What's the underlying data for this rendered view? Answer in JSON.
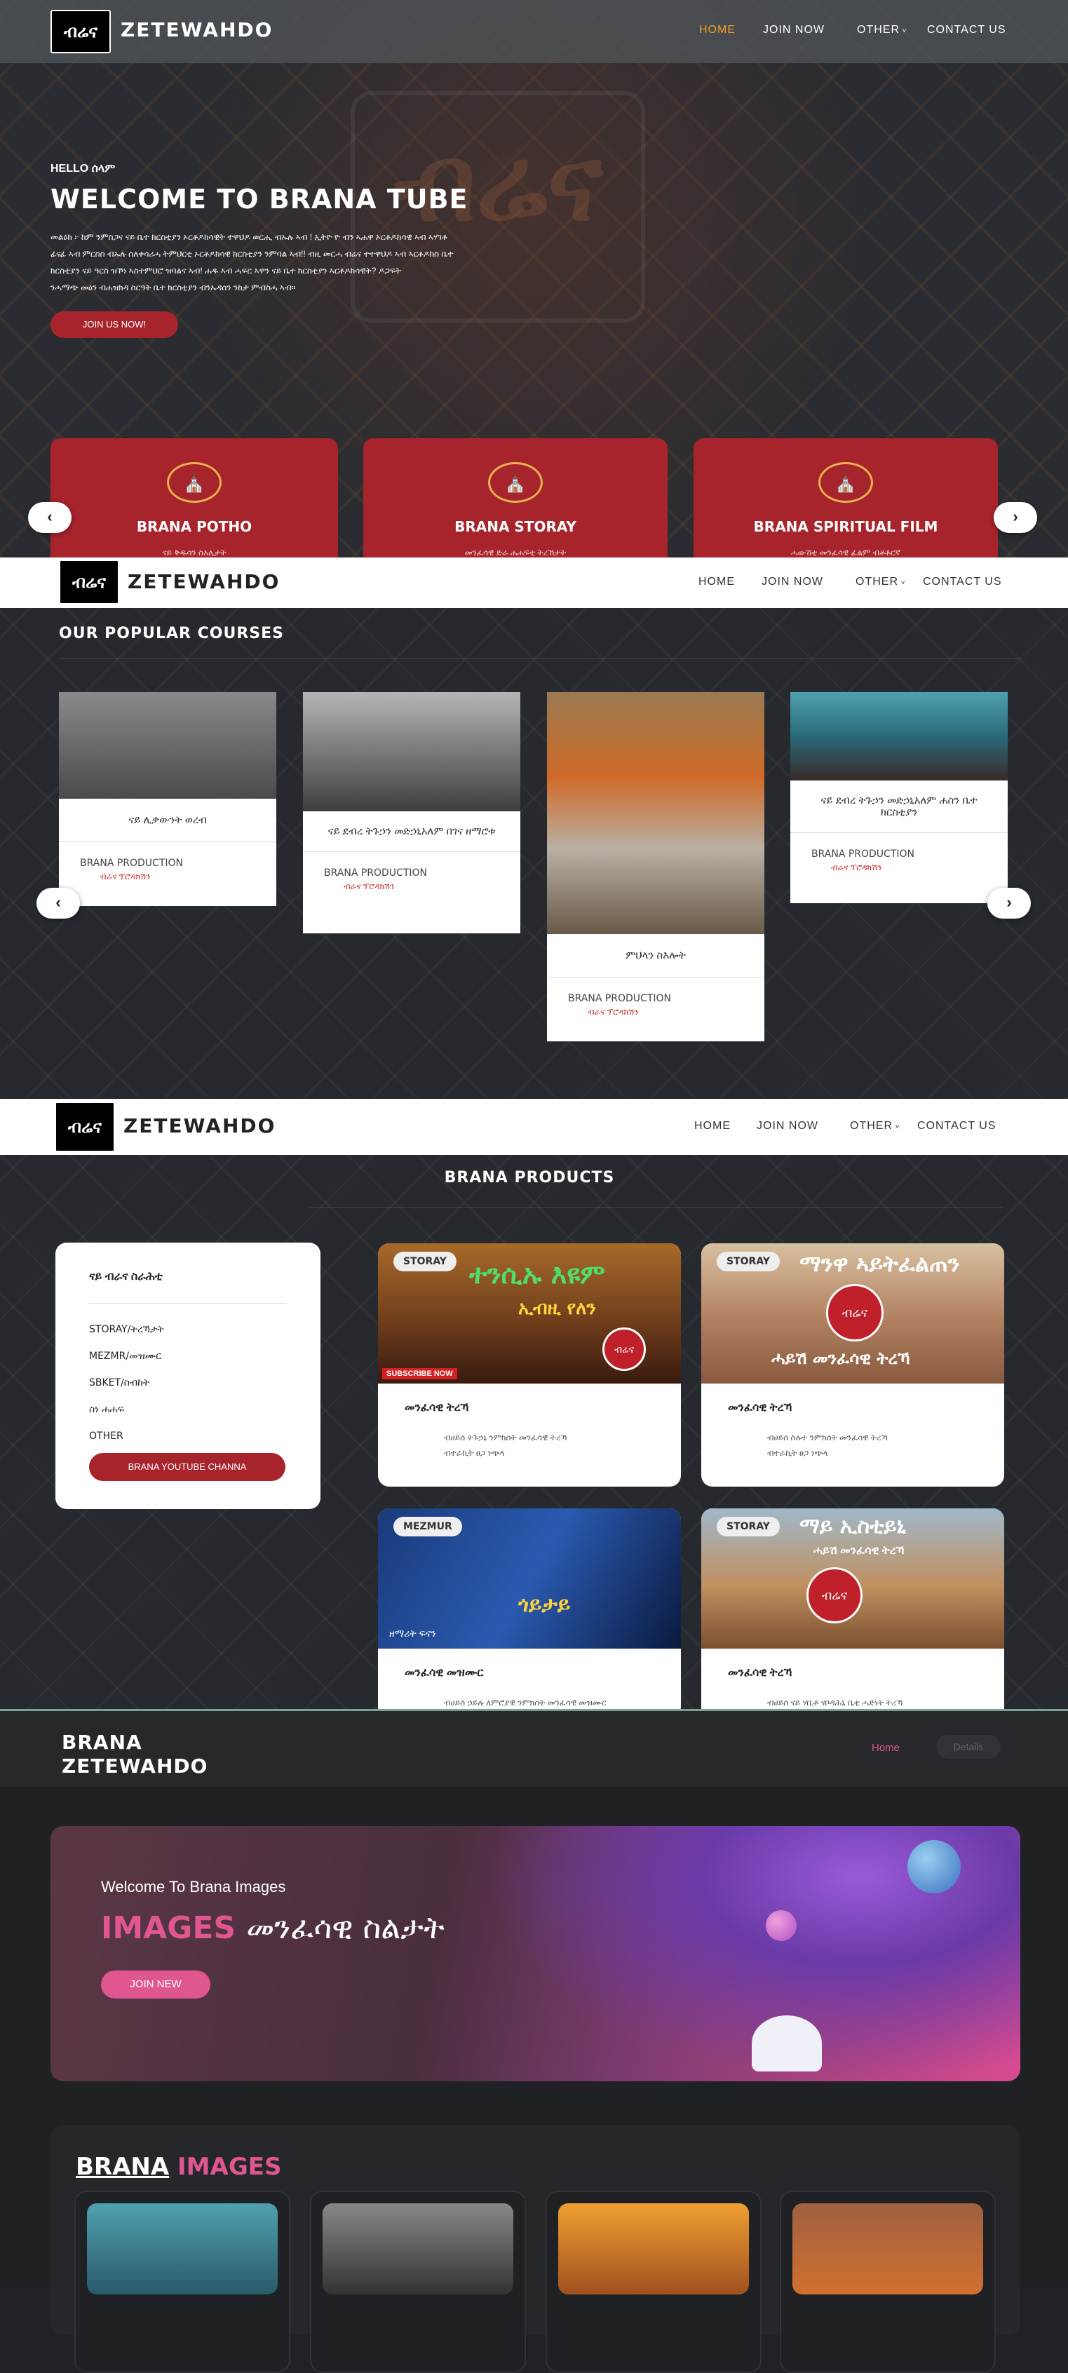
{
  "brand": "ZETEWAHDO",
  "logo_text": "ብሬና",
  "nav": {
    "home": "HOME",
    "join": "JOIN NOW",
    "other": "OTHER",
    "contact": "CONTACT US"
  },
  "hero": {
    "hello": "HELLO ሰላም",
    "title": "WELCOME TO BRANA TUBE",
    "body_line1": "መልዕክ ፦ ከም ንምስጋና ናይ ቤተ ክርስቲያን ኦርቶዶክሳዊት ተዋህዶ ወርሒ ብኡሉ ኣብ ! ኢትዮ ዮ ብን ኣሐዋ ኦርቶዶክሳዊ ኣብ ኣሃገቶ",
    "body_line2": "ፊናፊ ኣብ ምርስስ ብኡሉ ሰለቀሳሪሓ ትምህርቲ ኦርቶዶክሳዊ ክርስቲያን ንምባል ኣብ!! ብዚ መርሓ ብሬና ተተዋህዶ ኣብ ኣርቶዶክስ ቤተ",
    "body_line3": "ክርስቲያን ናይ ዓርስ ዝኾነ ኣስተምህሮ ዝባልና ኣብ! ሐዱ ኣብ ሓፍር ኣዋን ናይ ቤተ ክርስቲያን ኣርቶዶክሳዊት? ዶጋፍት",
    "body_line4": "ንሓማጭ መዕን ብሐዝክዳ ስርዓት ቤተ ክርስቲያን ብንኡዳሰን ንከታ ምብስሓ ኣብ።",
    "join_btn": "JOIN US NOW!"
  },
  "feature_cards": [
    {
      "title": "BRANA POTHO",
      "sub": "ናይ ቅዱሳን ስእሊታት"
    },
    {
      "title": "BRANA STORAY",
      "sub": "መንፈሳዊ ድራ ሐሐፍቲ ትረኽታት"
    },
    {
      "title": "BRANA SPIRITUAL FILM",
      "sub": "ሓውሽቲ መንፈሳዊ ፊልም ብቶቶርኛ"
    }
  ],
  "courses": {
    "heading": "OUR POPULAR COURSES",
    "items": [
      {
        "title": "ናይ ሊቃውንት ወረብ",
        "prod": "BRANA PRODUCTION",
        "sub": "ብራና ፕሮዳክሽን"
      },
      {
        "title": "ናይ ደብረ ትጉኃን መድኃኒአለም በገና ዘማሮቱ",
        "prod": "BRANA PRODUCTION",
        "sub": "ብራና ፕሮዳክሽን"
      },
      {
        "title": "ምህላን ስእሎት",
        "prod": "BRANA PRODUCTION",
        "sub": "ብራና ፕሮዳክሽን"
      },
      {
        "title": "ናይ ደብረ ትጉኃን መድኃኒአለም ሐስን ቤተ ክርስቲያን",
        "prod": "BRANA PRODUCTION",
        "sub": "ብራና ፕሮዳክሽን"
      }
    ]
  },
  "products": {
    "heading": "BRANA PRODUCTS",
    "sidebar_title": "ናይ ብራና ስራሕቲ",
    "categories": [
      "STORAY/ትረኻታት",
      "MEZMR/መዝሙር",
      "SBKET/ስብከት",
      "ስነ ሐሐፍ",
      "OTHER"
    ],
    "youtube_btn": "BRANA YOUTUBE CHANNA",
    "cards": [
      {
        "badge": "STORAY",
        "img_title": "ተንሲኡ እዩም",
        "img_sub": "ኢብዚ የለን",
        "title": "መንፈሳዊ ትረኻ",
        "desc1": "ብሀይሰ ትጉኃኔ ንምክሰት መንፈሳዊ ትረኻ",
        "desc2": "ብተራኪት ፀጋ ነጭላ"
      },
      {
        "badge": "STORAY",
        "img_title": "ማንዋ ኣይትፈልጠን",
        "img_sub": "ሓይሽ መንፈሳዊ ትረኻ",
        "title": "መንፈሳዊ ትረኻ",
        "desc1": "ብሀይሰ ስሉተ ንምክሰት መንፈሳዊ ትረኻ",
        "desc2": "ብተራኪት ፀጋ ነጭላ"
      },
      {
        "badge": "MEZMUR",
        "img_title": "ጎይታይ",
        "img_sub": "ዘማሪት ፍናን",
        "title": "መንፈሳዊ መዝሙር",
        "desc1": "ብሀይሰ ኃይሉ ለምሮያዊ ንምክሰት መንፈሳዊ መዝሙር",
        "desc2": ""
      },
      {
        "badge": "STORAY",
        "img_title": "ማይ ኢስቲይኒ",
        "img_sub": "ሓይሽ መንፈሳዊ ትረኻ",
        "title": "መንፈሳዊ ትረኻ",
        "desc1": "ብሀይሰ ናይ ሃቢቶ ናቦዳሕኒ ቤቲ ሓድነት ትረኻ",
        "desc2": ""
      }
    ]
  },
  "images_section": {
    "brand_line1": "BRANA",
    "brand_line2": "ZETEWAHDO",
    "crumb_home": "Home",
    "crumb_details": "Details",
    "welcome": "Welcome To Brana Images",
    "images_word": "IMAGES",
    "images_amharic": "መንፈሳዊ ስልታት",
    "join_btn": "JOIN NEW",
    "gallery_brana": "BRANA",
    "gallery_images": "IMAGES"
  },
  "colors": {
    "accent_orange": "#f0a020",
    "brand_red": "#a8242c",
    "pink": "#e0568f"
  }
}
